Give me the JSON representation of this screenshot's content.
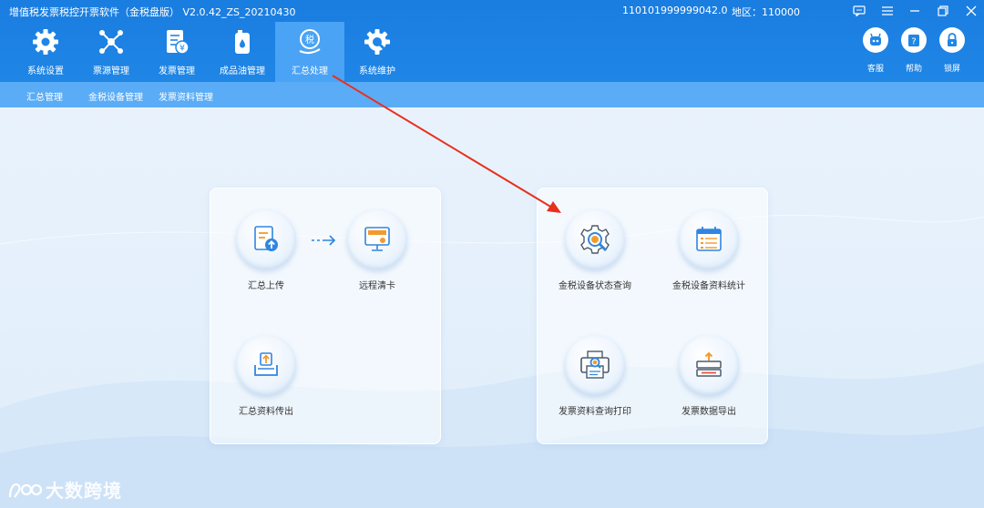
{
  "app": {
    "title": "增值税发票税控开票软件（金税盘版） V2.0.42_ZS_20210430",
    "tax_id": "110101999999042.0",
    "region": "地区：110000"
  },
  "window_controls": [
    "message-icon",
    "menu-icon",
    "minimize-icon",
    "restore-icon",
    "close-icon"
  ],
  "nav": {
    "active": "汇总处理",
    "items": [
      {
        "label": "系统设置",
        "icon": "gear-icon"
      },
      {
        "label": "票源管理",
        "icon": "network-icon"
      },
      {
        "label": "发票管理",
        "icon": "invoice-icon"
      },
      {
        "label": "成品油管理",
        "icon": "oil-drum-icon"
      },
      {
        "label": "汇总处理",
        "icon": "tax-summary-icon"
      },
      {
        "label": "系统维护",
        "icon": "maintenance-gear-icon"
      }
    ]
  },
  "tools": [
    {
      "label": "客服",
      "icon": "robot-icon"
    },
    {
      "label": "帮助",
      "icon": "help-icon"
    },
    {
      "label": "锁屏",
      "icon": "lock-icon"
    }
  ],
  "subnav": [
    "汇总管理",
    "金税设备管理",
    "发票资料管理"
  ],
  "panels": {
    "left": [
      {
        "label": "汇总上传",
        "icon": "summary-upload-icon"
      },
      {
        "label": "远程清卡",
        "icon": "remote-clear-card-icon"
      },
      {
        "label": "汇总资料传出",
        "icon": "summary-export-icon"
      }
    ],
    "right": [
      {
        "label": "金税设备状态查询",
        "icon": "device-status-query-icon"
      },
      {
        "label": "金税设备资料统计",
        "icon": "device-statistics-icon"
      },
      {
        "label": "发票资料查询打印",
        "icon": "invoice-print-icon"
      },
      {
        "label": "发票数据导出",
        "icon": "invoice-data-export-icon"
      }
    ]
  },
  "watermark": "大数跨境",
  "colors": {
    "topbar": "#1f86e6",
    "nav_active": "#4aa3f5",
    "subnav": "#5aacf6",
    "icon_blue": "#2f86e0",
    "icon_orange": "#f39a2d",
    "annotation_red": "#e8301c"
  }
}
